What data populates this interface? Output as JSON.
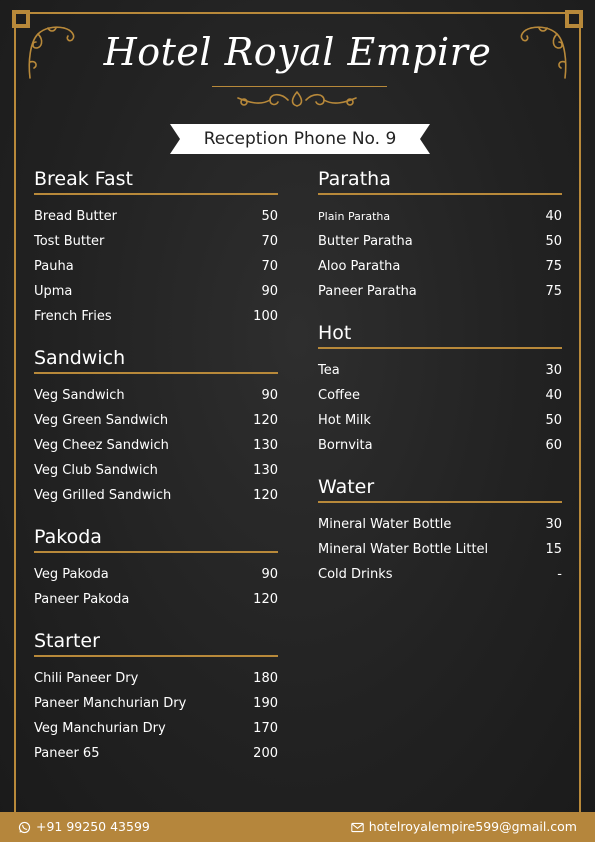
{
  "title": "Hotel Royal Empire",
  "ribbon": "Reception Phone No. 9",
  "colors": {
    "gold": "#b8893a",
    "background": "#222222",
    "footer": "#b5863c"
  },
  "left_sections": [
    {
      "title": "Break Fast",
      "items": [
        {
          "name": "Bread Butter",
          "price": "50"
        },
        {
          "name": "Tost Butter",
          "price": "70"
        },
        {
          "name": "Pauha",
          "price": "70"
        },
        {
          "name": "Upma",
          "price": "90"
        },
        {
          "name": "French Fries",
          "price": "100"
        }
      ]
    },
    {
      "title": "Sandwich",
      "items": [
        {
          "name": "Veg Sandwich",
          "price": "90"
        },
        {
          "name": "Veg Green Sandwich",
          "price": "120"
        },
        {
          "name": "Veg Cheez Sandwich",
          "price": "130"
        },
        {
          "name": "Veg Club Sandwich",
          "price": "130"
        },
        {
          "name": "Veg Grilled Sandwich",
          "price": "120"
        }
      ]
    },
    {
      "title": "Pakoda",
      "items": [
        {
          "name": "Veg Pakoda",
          "price": "90"
        },
        {
          "name": "Paneer Pakoda",
          "price": "120"
        }
      ]
    },
    {
      "title": "Starter",
      "items": [
        {
          "name": "Chili Paneer Dry",
          "price": "180"
        },
        {
          "name": "Paneer Manchurian Dry",
          "price": "190"
        },
        {
          "name": "Veg Manchurian Dry",
          "price": "170"
        },
        {
          "name": "Paneer 65",
          "price": "200"
        }
      ]
    }
  ],
  "right_sections": [
    {
      "title": "Paratha",
      "items": [
        {
          "name": "Plain Paratha",
          "price": "40"
        },
        {
          "name": "Butter Paratha",
          "price": "50"
        },
        {
          "name": "Aloo Paratha",
          "price": "75"
        },
        {
          "name": "Paneer Paratha",
          "price": "75"
        }
      ]
    },
    {
      "title": "Hot",
      "items": [
        {
          "name": "Tea",
          "price": "30"
        },
        {
          "name": "Coffee",
          "price": "40"
        },
        {
          "name": "Hot Milk",
          "price": "50"
        },
        {
          "name": "Bornvita",
          "price": "60"
        }
      ]
    },
    {
      "title": "Water",
      "items": [
        {
          "name": "Mineral Water Bottle",
          "price": "30"
        },
        {
          "name": "Mineral Water Bottle Littel",
          "price": "15"
        },
        {
          "name": "Cold Drinks",
          "price": "-"
        }
      ]
    }
  ],
  "footer": {
    "phone": "+91 99250 43599",
    "phone_icon": "whatsapp-icon",
    "email": "hotelroyalempire599@gmail.com",
    "email_icon": "mail-icon"
  }
}
